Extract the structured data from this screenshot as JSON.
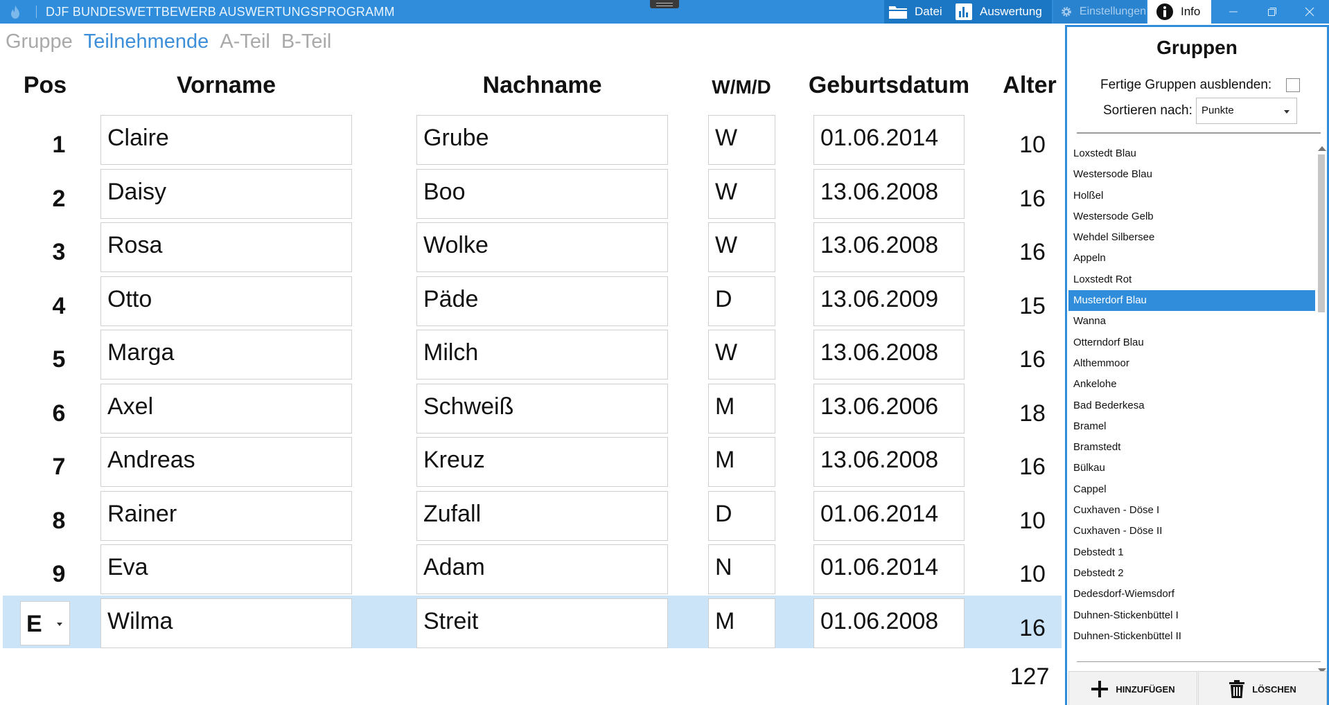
{
  "window": {
    "title": "DJF BUNDESWETTBEWERB AUSWERTUNGSPROGRAMM",
    "buttons": {
      "datei": "Datei",
      "auswertung": "Auswertung",
      "einstellungen": "Einstellungen",
      "info": "Info"
    }
  },
  "tabs": [
    {
      "label": "Gruppe",
      "active": false
    },
    {
      "label": "Teilnehmende",
      "active": true
    },
    {
      "label": "A-Teil",
      "active": false
    },
    {
      "label": "B-Teil",
      "active": false
    }
  ],
  "table": {
    "headers": {
      "pos": "Pos",
      "vorname": "Vorname",
      "nachname": "Nachname",
      "wmd": "W/M/D",
      "geburtsdatum": "Geburtsdatum",
      "alter": "Alter"
    },
    "rows": [
      {
        "pos": "1",
        "vorname": "Claire",
        "nachname": "Grube",
        "wmd": "W",
        "geburtsdatum": "01.06.2014",
        "alter": "10"
      },
      {
        "pos": "2",
        "vorname": "Daisy",
        "nachname": "Boo",
        "wmd": "W",
        "geburtsdatum": "13.06.2008",
        "alter": "16"
      },
      {
        "pos": "3",
        "vorname": "Rosa",
        "nachname": "Wolke",
        "wmd": "W",
        "geburtsdatum": "13.06.2008",
        "alter": "16"
      },
      {
        "pos": "4",
        "vorname": "Otto",
        "nachname": "Päde",
        "wmd": "D",
        "geburtsdatum": "13.06.2009",
        "alter": "15"
      },
      {
        "pos": "5",
        "vorname": "Marga",
        "nachname": "Milch",
        "wmd": "W",
        "geburtsdatum": "13.06.2008",
        "alter": "16"
      },
      {
        "pos": "6",
        "vorname": "Axel",
        "nachname": "Schweiß",
        "wmd": "M",
        "geburtsdatum": "13.06.2006",
        "alter": "18"
      },
      {
        "pos": "7",
        "vorname": "Andreas",
        "nachname": "Kreuz",
        "wmd": "M",
        "geburtsdatum": "13.06.2008",
        "alter": "16"
      },
      {
        "pos": "8",
        "vorname": "Rainer",
        "nachname": "Zufall",
        "wmd": "D",
        "geburtsdatum": "01.06.2014",
        "alter": "10"
      },
      {
        "pos": "9",
        "vorname": "Eva",
        "nachname": "Adam",
        "wmd": "N",
        "geburtsdatum": "01.06.2014",
        "alter": "10"
      },
      {
        "pos": "E",
        "vorname": "Wilma",
        "nachname": "Streit",
        "wmd": "M",
        "geburtsdatum": "01.06.2008",
        "alter": "16"
      }
    ],
    "total_age": "127"
  },
  "panel": {
    "title": "Gruppen",
    "hide_finished_label": "Fertige Gruppen ausblenden:",
    "hide_finished_checked": false,
    "sort_label": "Sortieren nach:",
    "sort_value": "Punkte",
    "groups": [
      "Loxstedt Blau",
      "Westersode Blau",
      "Holßel",
      "Westersode Gelb",
      "Wehdel Silbersee",
      "Appeln",
      "Loxstedt Rot",
      "Musterdorf Blau",
      "Wanna",
      "Otterndorf Blau",
      "Althemmoor",
      "Ankelohe",
      "Bad Bederkesa",
      "Bramel",
      "Bramstedt",
      "Bülkau",
      "Cappel",
      "Cuxhaven - Döse I",
      "Cuxhaven - Döse II",
      "Debstedt 1",
      "Debstedt 2",
      "Dedesdorf-Wiemsdorf",
      "Duhnen-Stickenbüttel I",
      "Duhnen-Stickenbüttel II"
    ],
    "selected_group": "Musterdorf Blau",
    "add_label": "HINZUFÜGEN",
    "delete_label": "LÖSCHEN"
  },
  "colors": {
    "accent": "#2f8ddc",
    "selected_row": "#cce4f7",
    "tab_active": "#3c8fd8",
    "tab_inactive": "#a9a9a9"
  },
  "icons": {
    "app": "flame-icon",
    "datei": "folder-icon",
    "auswertung": "bar-chart-icon",
    "einstellungen": "gear-icon",
    "info": "info-icon",
    "add": "plus-icon",
    "delete": "trash-icon"
  }
}
